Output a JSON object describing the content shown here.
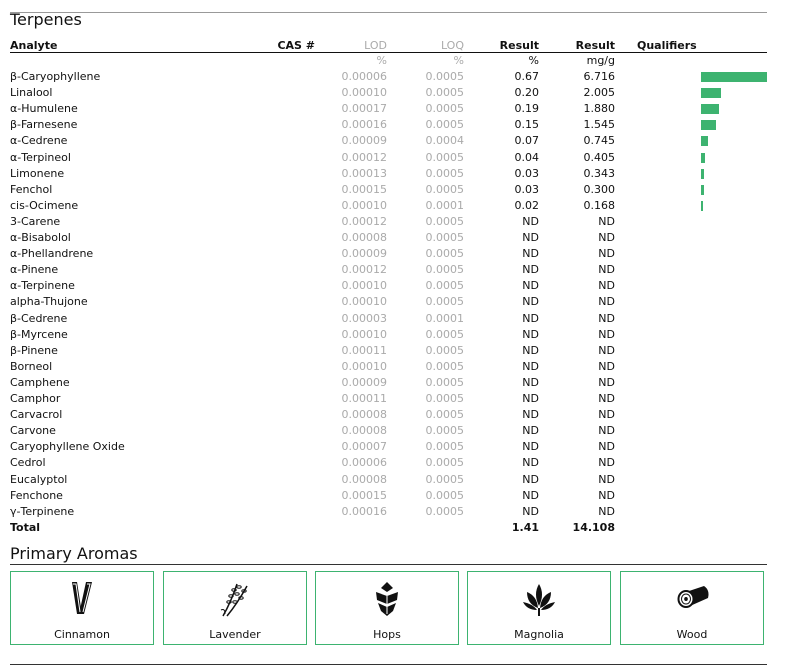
{
  "terpenes": {
    "title": "Terpenes",
    "columns": {
      "analyte": "Analyte",
      "cas": "CAS #",
      "lod": "LOD",
      "loq": "LOQ",
      "result_pct": "Result",
      "result_mg": "Result",
      "qualifiers": "Qualifiers"
    },
    "units": {
      "lod": "%",
      "loq": "%",
      "result_pct": "%",
      "result_mg": "mg/g"
    },
    "rows": [
      {
        "name": "β-Caryophyllene",
        "lod": "0.00006",
        "loq": "0.0005",
        "pct": "0.67",
        "mg": "6.716",
        "bar": 6.716
      },
      {
        "name": "Linalool",
        "lod": "0.00010",
        "loq": "0.0005",
        "pct": "0.20",
        "mg": "2.005",
        "bar": 2.005
      },
      {
        "name": "α-Humulene",
        "lod": "0.00017",
        "loq": "0.0005",
        "pct": "0.19",
        "mg": "1.880",
        "bar": 1.88
      },
      {
        "name": "β-Farnesene",
        "lod": "0.00016",
        "loq": "0.0005",
        "pct": "0.15",
        "mg": "1.545",
        "bar": 1.545
      },
      {
        "name": "α-Cedrene",
        "lod": "0.00009",
        "loq": "0.0004",
        "pct": "0.07",
        "mg": "0.745",
        "bar": 0.745
      },
      {
        "name": "α-Terpineol",
        "lod": "0.00012",
        "loq": "0.0005",
        "pct": "0.04",
        "mg": "0.405",
        "bar": 0.405
      },
      {
        "name": "Limonene",
        "lod": "0.00013",
        "loq": "0.0005",
        "pct": "0.03",
        "mg": "0.343",
        "bar": 0.343
      },
      {
        "name": "Fenchol",
        "lod": "0.00015",
        "loq": "0.0005",
        "pct": "0.03",
        "mg": "0.300",
        "bar": 0.3
      },
      {
        "name": "cis-Ocimene",
        "lod": "0.00010",
        "loq": "0.0001",
        "pct": "0.02",
        "mg": "0.168",
        "bar": 0.168
      },
      {
        "name": "3-Carene",
        "lod": "0.00012",
        "loq": "0.0005",
        "pct": "ND",
        "mg": "ND",
        "bar": 0
      },
      {
        "name": "α-Bisabolol",
        "lod": "0.00008",
        "loq": "0.0005",
        "pct": "ND",
        "mg": "ND",
        "bar": 0
      },
      {
        "name": "α-Phellandrene",
        "lod": "0.00009",
        "loq": "0.0005",
        "pct": "ND",
        "mg": "ND",
        "bar": 0
      },
      {
        "name": "α-Pinene",
        "lod": "0.00012",
        "loq": "0.0005",
        "pct": "ND",
        "mg": "ND",
        "bar": 0
      },
      {
        "name": "α-Terpinene",
        "lod": "0.00010",
        "loq": "0.0005",
        "pct": "ND",
        "mg": "ND",
        "bar": 0
      },
      {
        "name": "alpha-Thujone",
        "lod": "0.00010",
        "loq": "0.0005",
        "pct": "ND",
        "mg": "ND",
        "bar": 0
      },
      {
        "name": "β-Cedrene",
        "lod": "0.00003",
        "loq": "0.0001",
        "pct": "ND",
        "mg": "ND",
        "bar": 0
      },
      {
        "name": "β-Myrcene",
        "lod": "0.00010",
        "loq": "0.0005",
        "pct": "ND",
        "mg": "ND",
        "bar": 0
      },
      {
        "name": "β-Pinene",
        "lod": "0.00011",
        "loq": "0.0005",
        "pct": "ND",
        "mg": "ND",
        "bar": 0
      },
      {
        "name": "Borneol",
        "lod": "0.00010",
        "loq": "0.0005",
        "pct": "ND",
        "mg": "ND",
        "bar": 0
      },
      {
        "name": "Camphene",
        "lod": "0.00009",
        "loq": "0.0005",
        "pct": "ND",
        "mg": "ND",
        "bar": 0
      },
      {
        "name": "Camphor",
        "lod": "0.00011",
        "loq": "0.0005",
        "pct": "ND",
        "mg": "ND",
        "bar": 0
      },
      {
        "name": "Carvacrol",
        "lod": "0.00008",
        "loq": "0.0005",
        "pct": "ND",
        "mg": "ND",
        "bar": 0
      },
      {
        "name": "Carvone",
        "lod": "0.00008",
        "loq": "0.0005",
        "pct": "ND",
        "mg": "ND",
        "bar": 0
      },
      {
        "name": "Caryophyllene Oxide",
        "lod": "0.00007",
        "loq": "0.0005",
        "pct": "ND",
        "mg": "ND",
        "bar": 0
      },
      {
        "name": "Cedrol",
        "lod": "0.00006",
        "loq": "0.0005",
        "pct": "ND",
        "mg": "ND",
        "bar": 0
      },
      {
        "name": "Eucalyptol",
        "lod": "0.00008",
        "loq": "0.0005",
        "pct": "ND",
        "mg": "ND",
        "bar": 0
      },
      {
        "name": "Fenchone",
        "lod": "0.00015",
        "loq": "0.0005",
        "pct": "ND",
        "mg": "ND",
        "bar": 0
      },
      {
        "name": "γ-Terpinene",
        "lod": "0.00016",
        "loq": "0.0005",
        "pct": "ND",
        "mg": "ND",
        "bar": 0
      }
    ],
    "total": {
      "label": "Total",
      "pct": "1.41",
      "mg": "14.108"
    },
    "bar_color": "#3db370",
    "bar_max_mg": 6.716
  },
  "aromas": {
    "title": "Primary Aromas",
    "border_color": "#3db370",
    "items": [
      {
        "label": "Cinnamon",
        "icon": "cinnamon-icon"
      },
      {
        "label": "Lavender",
        "icon": "lavender-icon"
      },
      {
        "label": "Hops",
        "icon": "hops-icon"
      },
      {
        "label": "Magnolia",
        "icon": "magnolia-icon"
      },
      {
        "label": "Wood",
        "icon": "wood-icon"
      }
    ]
  }
}
